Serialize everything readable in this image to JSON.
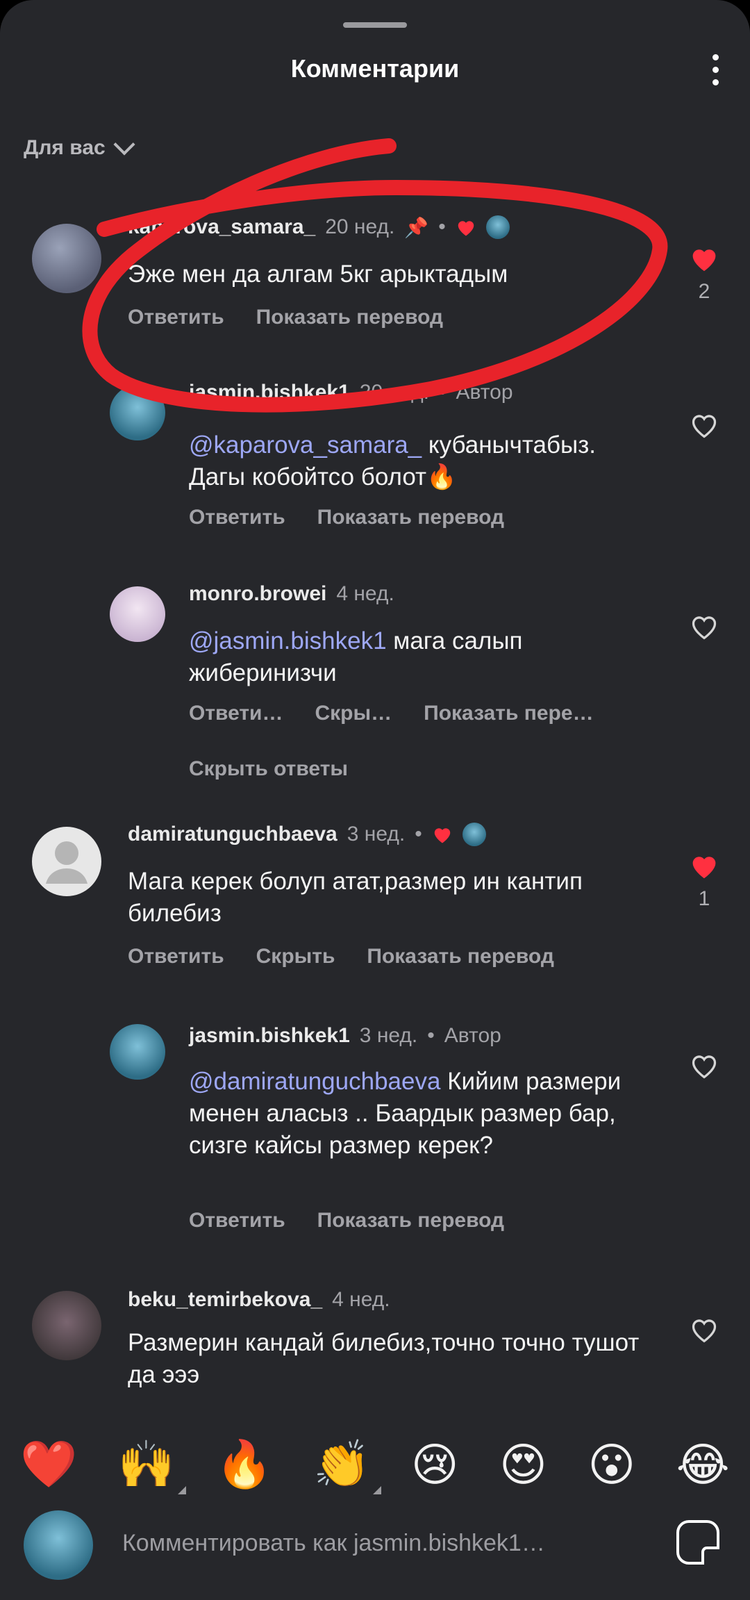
{
  "header": {
    "title": "Комментарии",
    "filter_label": "Для вас"
  },
  "comments": [
    {
      "user": "kaparova_samara_",
      "time": "20 нед.",
      "pinned": true,
      "liked_by_author": true,
      "text": "Эже мен да алгам 5кг арыктадым",
      "actions": [
        "Ответить",
        "Показать перевод"
      ],
      "likes": "2",
      "liked": true
    },
    {
      "user": "jasmin.bishkek1",
      "time": "20 нед.",
      "badge": "Автор",
      "mention": "@kaparova_samara_",
      "text": " кубанычтабыз. Дагы кобойтсо болот🔥",
      "actions": [
        "Ответить",
        "Показать перевод"
      ]
    },
    {
      "user": "monro.browei",
      "time": "4 нед.",
      "mention": "@jasmin.bishkek1",
      "text": " мага салып жиберинизчи",
      "actions": [
        "Ответи…",
        "Скры…",
        "Показать пере…"
      ],
      "hide_replies": "Скрыть ответы"
    },
    {
      "user": "damiratunguchbaeva",
      "time": "3 нед.",
      "liked_by_author": true,
      "text": "Мага керек болуп атат,размер ин кантип билебиз",
      "actions": [
        "Ответить",
        "Скрыть",
        "Показать перевод"
      ],
      "likes": "1",
      "liked": true
    },
    {
      "user": "jasmin.bishkek1",
      "time": "3 нед.",
      "badge": "Автор",
      "mention": "@damiratunguchbaeva",
      "text": " Кийим размери менен аласыз .. Баардык размер бар, сизге кайсы размер керек?",
      "actions": [
        "Ответить",
        "Показать перевод"
      ]
    },
    {
      "user": "beku_temirbekova_",
      "time": "4 нед.",
      "text": "Размерин кандай билебиз,точно точно тушот да эээ"
    }
  ],
  "reactions": [
    "❤️",
    "🙌",
    "🔥",
    "👏",
    "😢",
    "😍",
    "😮",
    "😂"
  ],
  "composer": {
    "placeholder": "Комментировать как jasmin.bishkek1…"
  },
  "colors": {
    "background": "#26272b",
    "like_red": "#ff3040",
    "mention": "#9da7f5",
    "annotation_red": "#e8232a"
  }
}
